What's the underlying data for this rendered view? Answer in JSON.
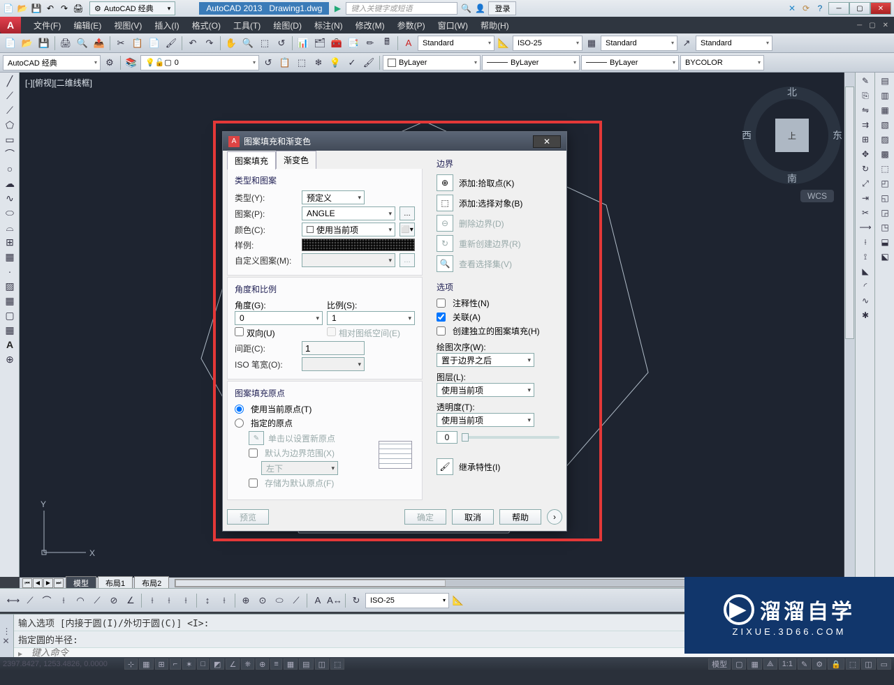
{
  "titlebar": {
    "workspace_label": "AutoCAD 经典",
    "app_title": "AutoCAD 2013",
    "doc_title": "Drawing1.dwg",
    "search_placeholder": "键入关键字或短语",
    "login": "登录"
  },
  "menubar": {
    "file": "文件(F)",
    "edit": "编辑(E)",
    "view": "视图(V)",
    "insert": "插入(I)",
    "format": "格式(O)",
    "tools": "工具(T)",
    "draw": "绘图(D)",
    "dimension": "标注(N)",
    "modify": "修改(M)",
    "param": "参数(P)",
    "window": "窗口(W)",
    "help": "帮助(H)"
  },
  "toolbar2": {
    "standard": "Standard",
    "iso25": "ISO-25",
    "standard2": "Standard",
    "standard3": "Standard"
  },
  "toolbar3": {
    "workspace": "AutoCAD 经典",
    "zero": "0",
    "bylayer1": "ByLayer",
    "bylayer2": "ByLayer",
    "bylayer3": "ByLayer",
    "bycolor": "BYCOLOR"
  },
  "viewport": {
    "label": "[-][俯视][二维线框]",
    "cube_top": "上",
    "north": "北",
    "south": "南",
    "east": "东",
    "west": "西",
    "wcs": "WCS",
    "y_axis": "Y",
    "x_axis": "X"
  },
  "dialog": {
    "title": "图案填充和渐变色",
    "tab_hatch": "图案填充",
    "tab_gradient": "渐变色",
    "group_type": "类型和图案",
    "lbl_type": "类型(Y):",
    "val_type": "预定义",
    "lbl_pattern": "图案(P):",
    "val_pattern": "ANGLE",
    "lbl_color": "颜色(C):",
    "val_color": "使用当前项",
    "lbl_sample": "样例:",
    "lbl_custom": "自定义图案(M):",
    "group_angle": "角度和比例",
    "lbl_angle": "角度(G):",
    "val_angle": "0",
    "lbl_scale": "比例(S):",
    "val_scale": "1",
    "chk_double": "双向(U)",
    "chk_paper": "相对图纸空间(E)",
    "lbl_spacing": "间距(C):",
    "val_spacing": "1",
    "lbl_isowidth": "ISO 笔宽(O):",
    "group_origin": "图案填充原点",
    "radio_current": "使用当前原点(T)",
    "radio_spec": "指定的原点",
    "btn_click_origin": "单击以设置新原点",
    "chk_default_ext": "默认为边界范围(X)",
    "ext_value": "左下",
    "chk_store": "存储为默认原点(F)",
    "sect_boundary": "边界",
    "btn_pickpoints": "添加:拾取点(K)",
    "btn_selobjs": "添加:选择对象(B)",
    "btn_remove": "删除边界(D)",
    "btn_recreate": "重新创建边界(R)",
    "btn_viewsel": "查看选择集(V)",
    "sect_options": "选项",
    "chk_annotative": "注释性(N)",
    "chk_assoc": "关联(A)",
    "chk_separate": "创建独立的图案填充(H)",
    "lbl_draworder": "绘图次序(W):",
    "val_draworder": "置于边界之后",
    "lbl_layer": "图层(L):",
    "val_layer": "使用当前项",
    "lbl_trans": "透明度(T):",
    "val_trans": "使用当前项",
    "trans_num": "0",
    "btn_inherit": "继承特性(I)",
    "btn_preview": "预览",
    "btn_ok": "确定",
    "btn_cancel": "取消",
    "btn_help": "帮助"
  },
  "tabs": {
    "model": "模型",
    "layout1": "布局1",
    "layout2": "布局2"
  },
  "bottombar": {
    "dimstyle": "ISO-25"
  },
  "command": {
    "line1": "输入选项 [内接于圆(I)/外切于圆(C)] <I>:",
    "line2": "指定圆的半径:",
    "prompt": "键入命令"
  },
  "status": {
    "coords": "2397.8427, 1253.4826, 0.0000",
    "model": "模型",
    "scale": "1:1",
    "annoscale": "▲"
  },
  "watermark": {
    "main": "溜溜自学",
    "sub": "ZIXUE.3D66.COM"
  }
}
